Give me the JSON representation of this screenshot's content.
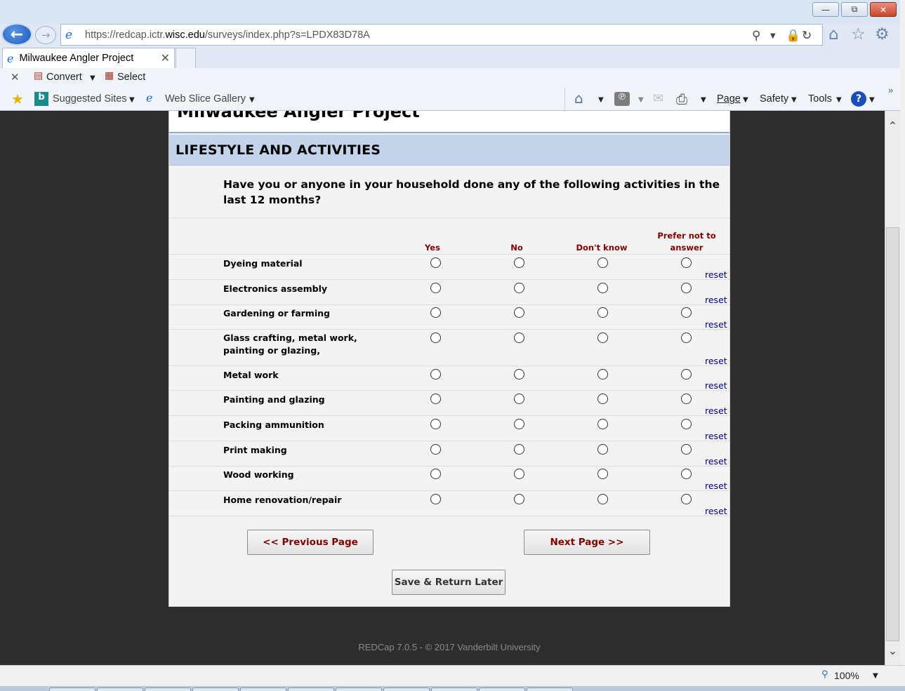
{
  "browser": {
    "url_prefix": "https://redcap.ictr.",
    "url_host": "wisc.edu",
    "url_suffix": "/surveys/index.php?s=LPDX83D78A",
    "tab_title": "Milwaukee Angler Project",
    "commands": {
      "convert": "Convert",
      "select": "Select",
      "suggested_sites": "Suggested Sites",
      "web_slice_gallery": "Web Slice Gallery",
      "page": "Page",
      "safety": "Safety",
      "tools": "Tools"
    },
    "zoom": "100%"
  },
  "survey": {
    "title": "Milwaukee Angler Project",
    "section": "LIFESTYLE AND ACTIVITIES",
    "question": "Have you or anyone in your household done any of the following activities in the last 12 months?",
    "columns": [
      "Yes",
      "No",
      "Don't know",
      "Prefer not to answer"
    ],
    "rows": [
      {
        "label": "Dyeing material",
        "reset": "reset"
      },
      {
        "label": "Electronics assembly",
        "reset": "reset"
      },
      {
        "label": "Gardening or farming",
        "reset": "reset"
      },
      {
        "label": "Glass crafting, metal work, painting or glazing,",
        "reset": "reset"
      },
      {
        "label": "Metal work",
        "reset": "reset"
      },
      {
        "label": "Painting and glazing",
        "reset": "reset"
      },
      {
        "label": "Packing ammunition",
        "reset": "reset"
      },
      {
        "label": "Print making",
        "reset": "reset"
      },
      {
        "label": "Wood working",
        "reset": "reset"
      },
      {
        "label": "Home renovation/repair",
        "reset": "reset"
      }
    ],
    "buttons": {
      "previous": "<< Previous Page",
      "next": "Next Page >>",
      "save": "Save & Return Later"
    },
    "footer": "REDCap 7.0.5 - © 2017 Vanderbilt University"
  }
}
